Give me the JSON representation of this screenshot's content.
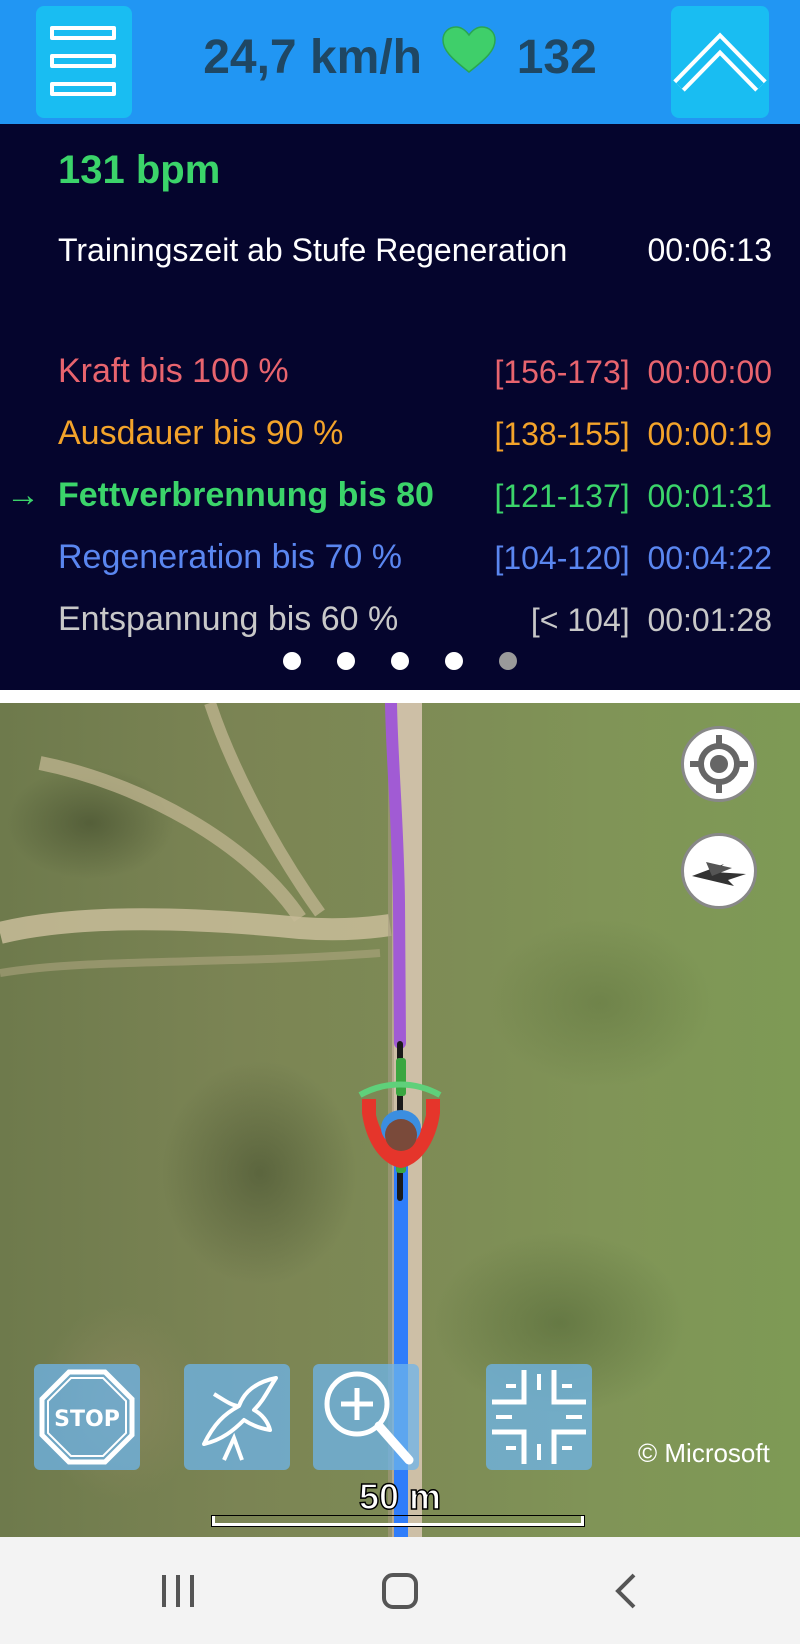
{
  "header": {
    "speed": "24,7 km/h",
    "heart_icon": "green-heart-icon",
    "heart_rate": "132"
  },
  "training": {
    "current_bpm": "131 bpm",
    "time_label": "Trainingszeit ab Stufe Regeneration",
    "time_value": "00:06:13",
    "active_indicator": "→",
    "zones": [
      {
        "label": "Kraft bis 100 %",
        "range": "[156-173]",
        "time": "00:00:00",
        "color": "#e8646e"
      },
      {
        "label": "Ausdauer bis 90 %",
        "range": "[138-155]",
        "time": "00:00:19",
        "color": "#f3a32a"
      },
      {
        "label": "Fettverbrennung bis 80",
        "range": "[121-137]",
        "time": "00:01:31",
        "color": "#3bd46a",
        "active": true
      },
      {
        "label": "Regeneration bis 70 %",
        "range": "[104-120]",
        "time": "00:04:22",
        "color": "#5a86f0"
      },
      {
        "label": "Entspannung bis 60 %",
        "range": "[< 104]",
        "time": "00:01:28",
        "color": "#c8c8c8"
      }
    ],
    "pager_dots": 5,
    "pager_active": 4
  },
  "map": {
    "copyright": "© Microsoft",
    "scale_label": "50 m",
    "route_past_color": "#9b59d0",
    "route_ahead_color": "#2f7dfa"
  }
}
